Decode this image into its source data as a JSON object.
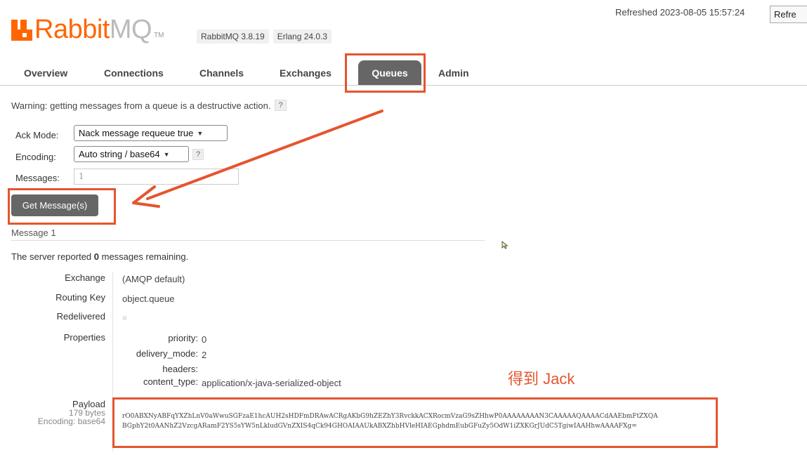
{
  "header": {
    "logo_main": "Rabbit",
    "logo_suffix": "MQ",
    "logo_tm": "TM",
    "version_rabbit": "RabbitMQ 3.8.19",
    "version_erlang": "Erlang 24.0.3",
    "refreshed": "Refreshed 2023-08-05 15:57:24",
    "refresh_button": "Refre"
  },
  "tabs": [
    {
      "label": "Overview",
      "active": false
    },
    {
      "label": "Connections",
      "active": false
    },
    {
      "label": "Channels",
      "active": false
    },
    {
      "label": "Exchanges",
      "active": false
    },
    {
      "label": "Queues",
      "active": true
    },
    {
      "label": "Admin",
      "active": false
    }
  ],
  "form": {
    "warning": "Warning: getting messages from a queue is a destructive action.",
    "help": "?",
    "ack_label": "Ack Mode:",
    "ack_value": "Nack message requeue true",
    "encoding_label": "Encoding:",
    "encoding_value": "Auto string / base64",
    "messages_label": "Messages:",
    "messages_value": "1",
    "get_button": "Get Message(s)"
  },
  "message": {
    "title": "Message 1",
    "server_prefix": "The server reported ",
    "server_count": "0",
    "server_suffix": " messages remaining.",
    "exchange_label": "Exchange",
    "exchange_value": "(AMQP default)",
    "routing_label": "Routing Key",
    "routing_value": "object.queue",
    "redelivered_label": "Redelivered",
    "redelivered_value": "○",
    "properties_label": "Properties",
    "properties": [
      {
        "key": "priority:",
        "value": "0"
      },
      {
        "key": "delivery_mode:",
        "value": "2"
      },
      {
        "key": "headers:",
        "value": ""
      },
      {
        "key": "content_type:",
        "value": "application/x-java-serialized-object"
      }
    ],
    "payload_label": "Payload",
    "payload_bytes": "179 bytes",
    "payload_encoding": "Encoding: base64",
    "payload_line1": "rO0ABXNyABFqYXZhLnV0aWwuSGFzaE1hcAUH2sHDFmDRAwACRgAKbG9hZEZhY3RvckkACXRocmVzaG9sZHhwP0AAAAAAAAN3CAAAAAQAAAACdAAEbmFtZXQA",
    "payload_line2": "BGphY2t0AANhZ2VzcgARamF2YS5sYW5nLkludGVnZXIS4qCk94GHOAIAAUkABXZhbHVleHIAEGphdmEubGFuZy5OdW1iZXKGrJUdC5TgiwIAAHhwAAAAFXg="
  },
  "annotation": {
    "text": "得到 Jack",
    "color": "#e4552e"
  },
  "colors": {
    "brand": "#ff6600",
    "tab_active": "#666666"
  }
}
